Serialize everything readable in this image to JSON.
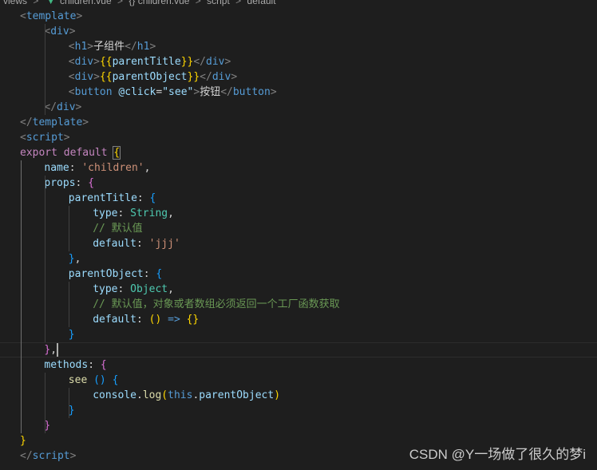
{
  "breadcrumb": {
    "items": [
      "views",
      "children.vue",
      "{} children.vue",
      "script",
      "default"
    ],
    "separator": ">"
  },
  "watermark": "CSDN @Y一场做了很久的梦i",
  "colors": {
    "background": "#1e1e1e",
    "tag": "#569cd6",
    "bracket_tag": "#808080",
    "text": "#d4d4d4",
    "attribute": "#9cdcfe",
    "string": "#ce9178",
    "keyword": "#c586c0",
    "comment": "#6a9955",
    "type": "#4ec9b0",
    "function": "#dcdcaa",
    "bracket_gold": "#ffd700",
    "bracket_pink": "#da70d6",
    "bracket_blue": "#179fff",
    "this": "#569cd6"
  },
  "code": [
    {
      "indent": 4,
      "tokens": [
        [
          "<",
          "p"
        ],
        [
          "template",
          "tg"
        ],
        [
          ">",
          "p"
        ]
      ]
    },
    {
      "indent": 8,
      "tokens": [
        [
          "<",
          "p"
        ],
        [
          "div",
          "tg"
        ],
        [
          ">",
          "p"
        ]
      ]
    },
    {
      "indent": 12,
      "tokens": [
        [
          "<",
          "p"
        ],
        [
          "h1",
          "tg"
        ],
        [
          ">",
          "p"
        ],
        [
          "子组件",
          "tx"
        ],
        [
          "</",
          "p"
        ],
        [
          "h1",
          "tg"
        ],
        [
          ">",
          "p"
        ]
      ]
    },
    {
      "indent": 12,
      "tokens": [
        [
          "<",
          "p"
        ],
        [
          "div",
          "tg"
        ],
        [
          ">",
          "p"
        ],
        [
          "{{",
          "bg"
        ],
        [
          "parentTitle",
          "at"
        ],
        [
          "}}",
          "bg"
        ],
        [
          "</",
          "p"
        ],
        [
          "div",
          "tg"
        ],
        [
          ">",
          "p"
        ]
      ]
    },
    {
      "indent": 12,
      "tokens": [
        [
          "<",
          "p"
        ],
        [
          "div",
          "tg"
        ],
        [
          ">",
          "p"
        ],
        [
          "{{",
          "bg"
        ],
        [
          "parentObject",
          "at"
        ],
        [
          "}}",
          "bg"
        ],
        [
          "</",
          "p"
        ],
        [
          "div",
          "tg"
        ],
        [
          ">",
          "p"
        ]
      ]
    },
    {
      "indent": 12,
      "tokens": [
        [
          "<",
          "p"
        ],
        [
          "button",
          "tg"
        ],
        [
          " ",
          "tx"
        ],
        [
          "@click",
          "at"
        ],
        [
          "=",
          "tx"
        ],
        [
          "\"see\"",
          "at"
        ],
        [
          ">",
          "p"
        ],
        [
          "按钮",
          "tx"
        ],
        [
          "</",
          "p"
        ],
        [
          "button",
          "tg"
        ],
        [
          ">",
          "p"
        ]
      ]
    },
    {
      "indent": 8,
      "tokens": [
        [
          "</",
          "p"
        ],
        [
          "div",
          "tg"
        ],
        [
          ">",
          "p"
        ]
      ]
    },
    {
      "indent": 4,
      "tokens": [
        [
          "</",
          "p"
        ],
        [
          "template",
          "tg"
        ],
        [
          ">",
          "p"
        ]
      ]
    },
    {
      "indent": 4,
      "tokens": [
        [
          "<",
          "p"
        ],
        [
          "script",
          "tg"
        ],
        [
          ">",
          "p"
        ]
      ]
    },
    {
      "indent": 4,
      "tokens": [
        [
          "export",
          "kw"
        ],
        [
          " ",
          "tx"
        ],
        [
          "default",
          "kw"
        ],
        [
          " ",
          "tx"
        ],
        [
          "{",
          "bgb"
        ]
      ]
    },
    {
      "indent": 8,
      "tokens": [
        [
          "name",
          "at"
        ],
        [
          ": ",
          "tx"
        ],
        [
          "'children'",
          "st"
        ],
        [
          ",",
          "tx"
        ]
      ]
    },
    {
      "indent": 8,
      "tokens": [
        [
          "props",
          "at"
        ],
        [
          ": ",
          "tx"
        ],
        [
          "{",
          "bp"
        ]
      ]
    },
    {
      "indent": 12,
      "tokens": [
        [
          "parentTitle",
          "at"
        ],
        [
          ": ",
          "tx"
        ],
        [
          "{",
          "bb"
        ]
      ]
    },
    {
      "indent": 16,
      "tokens": [
        [
          "type",
          "at"
        ],
        [
          ": ",
          "tx"
        ],
        [
          "String",
          "ty"
        ],
        [
          ",",
          "tx"
        ]
      ]
    },
    {
      "indent": 16,
      "tokens": [
        [
          "// 默认值",
          "cm"
        ]
      ]
    },
    {
      "indent": 16,
      "tokens": [
        [
          "default",
          "at"
        ],
        [
          ": ",
          "tx"
        ],
        [
          "'jjj'",
          "st"
        ]
      ]
    },
    {
      "indent": 12,
      "tokens": [
        [
          "}",
          "bb"
        ],
        [
          ",",
          "tx"
        ]
      ]
    },
    {
      "indent": 12,
      "tokens": [
        [
          "parentObject",
          "at"
        ],
        [
          ": ",
          "tx"
        ],
        [
          "{",
          "bb"
        ]
      ]
    },
    {
      "indent": 16,
      "tokens": [
        [
          "type",
          "at"
        ],
        [
          ": ",
          "tx"
        ],
        [
          "Object",
          "ty"
        ],
        [
          ",",
          "tx"
        ]
      ]
    },
    {
      "indent": 16,
      "tokens": [
        [
          "// 默认值，对象或者数组必须返回一个工厂函数获取",
          "cm"
        ]
      ]
    },
    {
      "indent": 16,
      "tokens": [
        [
          "default",
          "at"
        ],
        [
          ": ",
          "tx"
        ],
        [
          "()",
          "bg"
        ],
        [
          " ",
          "tx"
        ],
        [
          "=>",
          "kwb"
        ],
        [
          " ",
          "tx"
        ],
        [
          "{}",
          "bg"
        ]
      ]
    },
    {
      "indent": 12,
      "tokens": [
        [
          "}",
          "bb"
        ]
      ]
    },
    {
      "indent": 8,
      "tokens": [
        [
          "}",
          "bp"
        ],
        [
          ",",
          "tx"
        ]
      ],
      "current": true
    },
    {
      "indent": 8,
      "tokens": [
        [
          "methods",
          "at"
        ],
        [
          ": ",
          "tx"
        ],
        [
          "{",
          "bp"
        ]
      ]
    },
    {
      "indent": 12,
      "tokens": [
        [
          "see",
          "fn"
        ],
        [
          " ",
          "tx"
        ],
        [
          "()",
          "bb"
        ],
        [
          " ",
          "tx"
        ],
        [
          "{",
          "bb"
        ]
      ]
    },
    {
      "indent": 16,
      "tokens": [
        [
          "console",
          "at"
        ],
        [
          ".",
          "tx"
        ],
        [
          "log",
          "fn"
        ],
        [
          "(",
          "bg"
        ],
        [
          "this",
          "kwb"
        ],
        [
          ".",
          "tx"
        ],
        [
          "parentObject",
          "at"
        ],
        [
          ")",
          "bg"
        ]
      ]
    },
    {
      "indent": 12,
      "tokens": [
        [
          "}",
          "bb"
        ]
      ]
    },
    {
      "indent": 8,
      "tokens": [
        [
          "}",
          "bp"
        ]
      ]
    },
    {
      "indent": 4,
      "tokens": [
        [
          "}",
          "bgb"
        ]
      ]
    },
    {
      "indent": 4,
      "tokens": [
        [
          "</",
          "p"
        ],
        [
          "script",
          "tg"
        ],
        [
          ">",
          "p"
        ]
      ]
    }
  ]
}
